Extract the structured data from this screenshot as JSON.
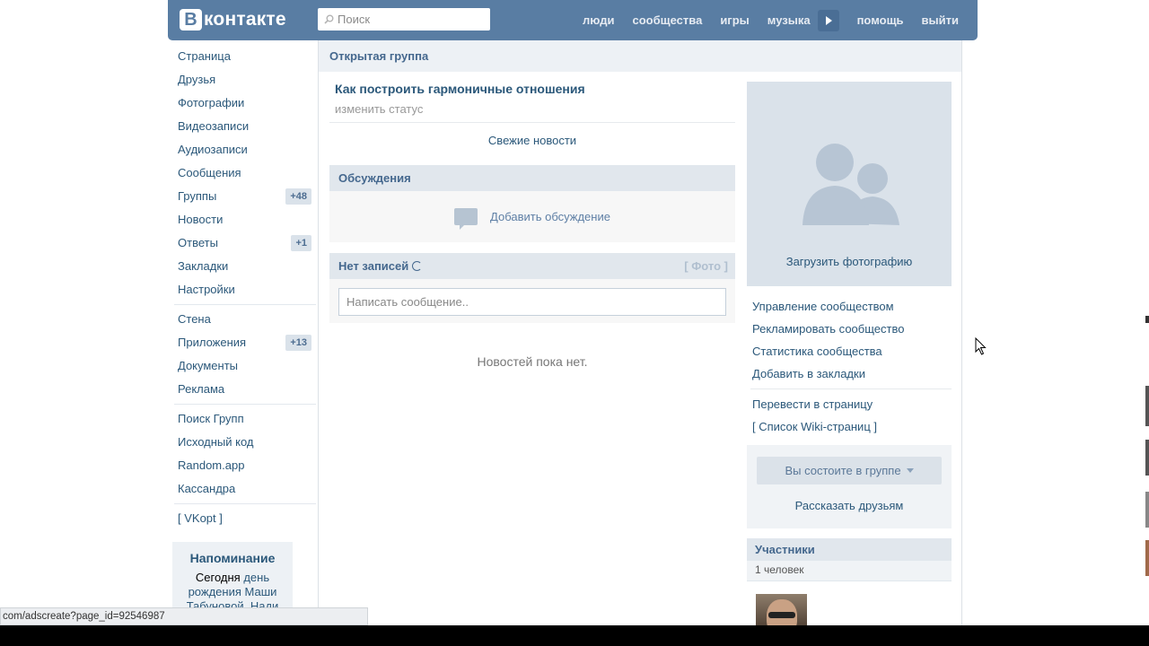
{
  "header": {
    "logo_letter": "В",
    "logo_text": "контакте",
    "search_placeholder": "Поиск",
    "nav": [
      "люди",
      "сообщества",
      "игры",
      "музыка",
      "помощь",
      "выйти"
    ],
    "accent_color": "#597da3"
  },
  "sidebar": {
    "group1": [
      {
        "label": "Страница",
        "count": ""
      },
      {
        "label": "Друзья",
        "count": ""
      },
      {
        "label": "Фотографии",
        "count": ""
      },
      {
        "label": "Видеозаписи",
        "count": ""
      },
      {
        "label": "Аудиозаписи",
        "count": ""
      },
      {
        "label": "Сообщения",
        "count": ""
      },
      {
        "label": "Группы",
        "count": "+48"
      },
      {
        "label": "Новости",
        "count": ""
      },
      {
        "label": "Ответы",
        "count": "+1"
      },
      {
        "label": "Закладки",
        "count": ""
      },
      {
        "label": "Настройки",
        "count": ""
      }
    ],
    "group2": [
      {
        "label": "Стена",
        "count": ""
      },
      {
        "label": "Приложения",
        "count": "+13"
      },
      {
        "label": "Документы",
        "count": ""
      },
      {
        "label": "Реклама",
        "count": ""
      }
    ],
    "group3": [
      {
        "label": "Поиск Групп",
        "count": ""
      },
      {
        "label": "Исходный код",
        "count": ""
      },
      {
        "label": "Random.app",
        "count": ""
      },
      {
        "label": "Кассандра",
        "count": ""
      }
    ],
    "group4": [
      {
        "label": "[ VKopt ]",
        "count": ""
      }
    ],
    "reminder": {
      "title": "Напоминание",
      "text_prefix": "Сегодня ",
      "birthday_link": "день рождения",
      "name_link": "Маши Табуновой, Нади Бадаевой, Катюши"
    }
  },
  "main": {
    "group_type": "Открытая группа",
    "group_name": "Как построить гармоничные отношения",
    "status_link": "изменить статус",
    "news_link": "Свежие новости",
    "discussions": {
      "title": "Обсуждения",
      "add_label": "Добавить обсуждение"
    },
    "wall": {
      "title": "Нет записей",
      "photo_link": "[ Фото ]",
      "input_placeholder": "Написать сообщение.."
    },
    "no_news": "Новостей пока нет."
  },
  "right": {
    "upload_photo": "Загрузить фотографию",
    "actions": [
      "Управление сообществом",
      "Рекламировать сообщество",
      "Статистика сообщества",
      "Добавить в закладки"
    ],
    "actions2": [
      "Перевести в страницу",
      "[ Список Wiki-страниц ]"
    ],
    "member_button": "Вы состоите в группе",
    "tell_friends": "Рассказать друзьям",
    "members_title": "Участники",
    "members_count": "1 человек"
  },
  "statusbar": {
    "url": "com/adscreate?page_id=92546987"
  }
}
